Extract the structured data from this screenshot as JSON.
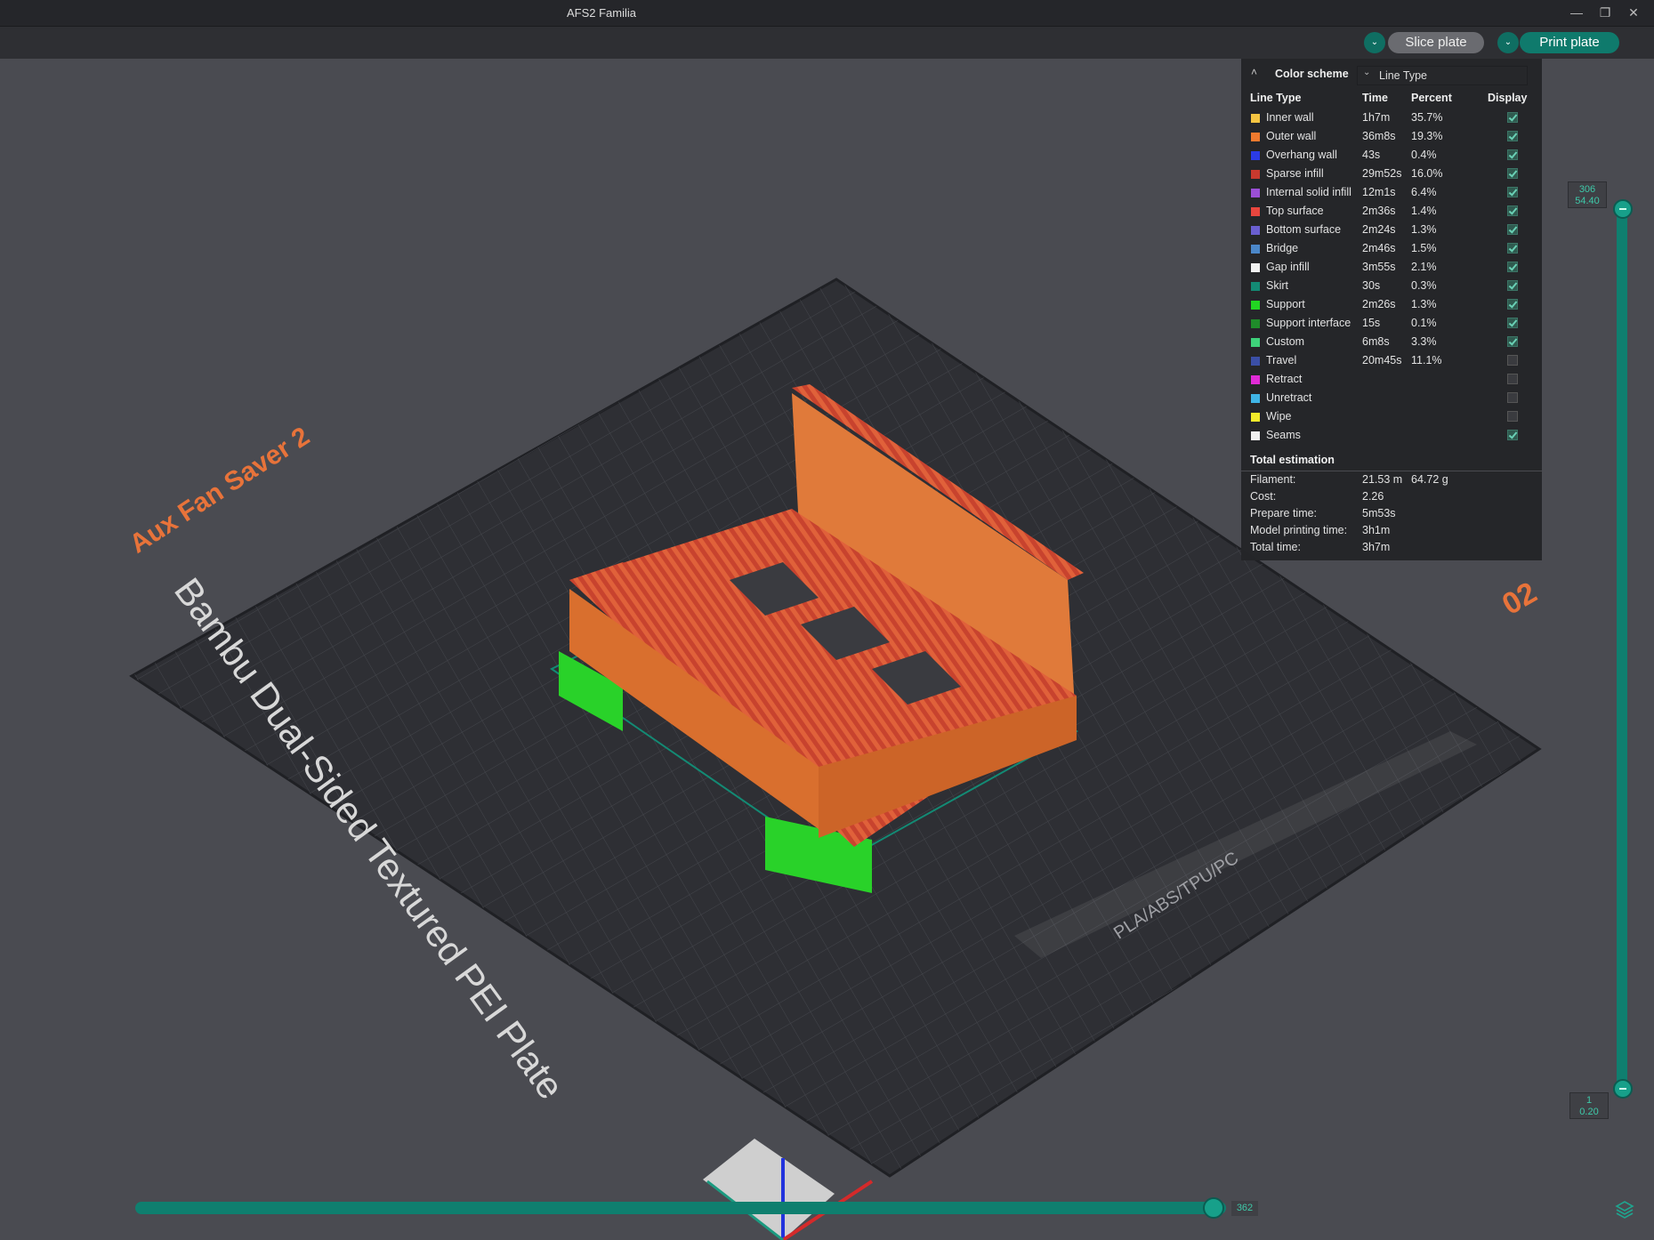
{
  "window": {
    "title": "AFS2 Familia"
  },
  "toolbar": {
    "slice_label": "Slice plate",
    "print_label": "Print plate"
  },
  "plate": {
    "model_name": "Aux Fan Saver 2",
    "plate_type": "Bambu Dual-Sided Textured PEI Plate",
    "plate_number": "02",
    "materials": "PLA/ABS/TPU/PC"
  },
  "legend": {
    "color_scheme_label": "Color scheme",
    "color_scheme_value": "Line Type",
    "headers": {
      "type": "Line Type",
      "time": "Time",
      "percent": "Percent",
      "display": "Display"
    },
    "rows": [
      {
        "name": "Inner wall",
        "time": "1h7m",
        "percent": "35.7%",
        "color": "#f5c542",
        "display": true
      },
      {
        "name": "Outer wall",
        "time": "36m8s",
        "percent": "19.3%",
        "color": "#f07a2e",
        "display": true
      },
      {
        "name": "Overhang wall",
        "time": "43s",
        "percent": "0.4%",
        "color": "#2b3be6",
        "display": true
      },
      {
        "name": "Sparse infill",
        "time": "29m52s",
        "percent": "16.0%",
        "color": "#c8392e",
        "display": true
      },
      {
        "name": "Internal solid infill",
        "time": "12m1s",
        "percent": "6.4%",
        "color": "#9b4fd6",
        "display": true
      },
      {
        "name": "Top surface",
        "time": "2m36s",
        "percent": "1.4%",
        "color": "#e8463e",
        "display": true
      },
      {
        "name": "Bottom surface",
        "time": "2m24s",
        "percent": "1.3%",
        "color": "#6a5fd0",
        "display": true
      },
      {
        "name": "Bridge",
        "time": "2m46s",
        "percent": "1.5%",
        "color": "#4b87c9",
        "display": true
      },
      {
        "name": "Gap infill",
        "time": "3m55s",
        "percent": "2.1%",
        "color": "#f2f2f2",
        "display": true
      },
      {
        "name": "Skirt",
        "time": "30s",
        "percent": "0.3%",
        "color": "#138a74",
        "display": true
      },
      {
        "name": "Support",
        "time": "2m26s",
        "percent": "1.3%",
        "color": "#22d622",
        "display": true
      },
      {
        "name": "Support interface",
        "time": "15s",
        "percent": "0.1%",
        "color": "#1f8c2a",
        "display": true
      },
      {
        "name": "Custom",
        "time": "6m8s",
        "percent": "3.3%",
        "color": "#3ed27a",
        "display": true
      },
      {
        "name": "Travel",
        "time": "20m45s",
        "percent": "11.1%",
        "color": "#3b4fa6",
        "display": false
      },
      {
        "name": "Retract",
        "time": "",
        "percent": "",
        "color": "#e02bd6",
        "display": false
      },
      {
        "name": "Unretract",
        "time": "",
        "percent": "",
        "color": "#3fb5e6",
        "display": false
      },
      {
        "name": "Wipe",
        "time": "",
        "percent": "",
        "color": "#f2ea2a",
        "display": false
      },
      {
        "name": "Seams",
        "time": "",
        "percent": "",
        "color": "#f0f0f0",
        "display": true
      }
    ],
    "total": {
      "title": "Total estimation",
      "filament_label": "Filament:",
      "filament_length": "21.53 m",
      "filament_weight": "64.72 g",
      "cost_label": "Cost:",
      "cost": "2.26",
      "prepare_label": "Prepare time:",
      "prepare": "5m53s",
      "model_label": "Model printing time:",
      "model": "3h1m",
      "total_label": "Total time:",
      "total": "3h7m"
    }
  },
  "layer_slider": {
    "top_layer": "306",
    "top_height": "54.40",
    "bottom_layer": "1",
    "bottom_height": "0.20"
  },
  "move_slider": {
    "value": "362"
  }
}
